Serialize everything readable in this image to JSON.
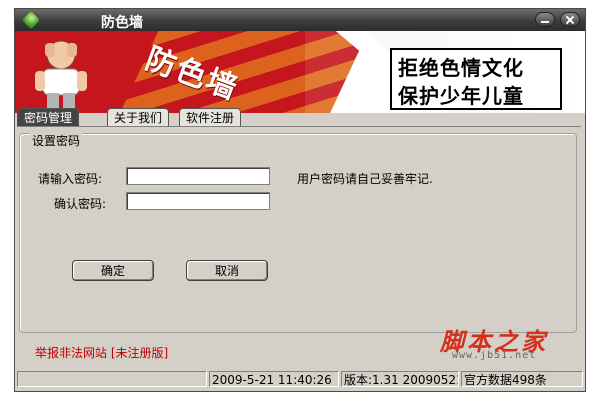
{
  "window": {
    "title": "防色墙"
  },
  "banner": {
    "brand": "防色墙",
    "slogan_line1": "拒绝色情文化",
    "slogan_line2": "保护少年儿童"
  },
  "tabs": [
    {
      "label": "密码管理",
      "active": true
    },
    {
      "label": "关于我们",
      "active": false
    },
    {
      "label": "软件注册",
      "active": false
    }
  ],
  "password_group": {
    "legend": "设置密码",
    "enter_label": "请输入密码:",
    "enter_value": "",
    "confirm_label": "确认密码:",
    "confirm_value": "",
    "hint": "用户密码请自己妥善牢记.",
    "ok_label": "确定",
    "cancel_label": "取消"
  },
  "footer": {
    "report_link": "举报非法网站 [未注册版]"
  },
  "statusbar": {
    "datetime": "2009-5-21 11:40:26",
    "version": "版本:1.31 20090521",
    "data_count": "官方数据498条"
  },
  "watermark": {
    "text": "脚本之家",
    "url": "www.jb51.net"
  },
  "colors": {
    "banner_red": "#c4161c",
    "banner_orange": "#e06b1d",
    "link_red": "#c00000",
    "titlebar": "#3c3c3c"
  }
}
